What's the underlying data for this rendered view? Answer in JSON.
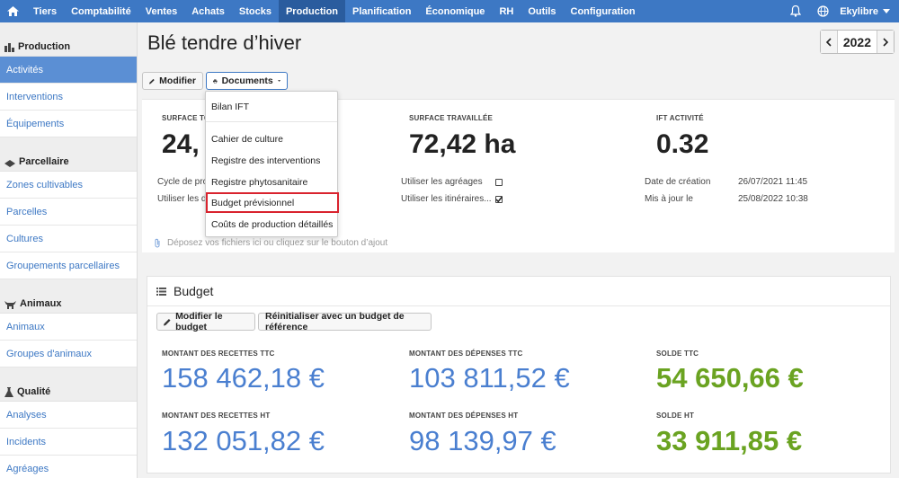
{
  "topnav": {
    "items": [
      "Tiers",
      "Comptabilité",
      "Ventes",
      "Achats",
      "Stocks",
      "Production",
      "Planification",
      "Économique",
      "RH",
      "Outils",
      "Configuration"
    ],
    "active": "Production",
    "user": "Ekylibre"
  },
  "sidebar": {
    "sections": [
      {
        "title": "Production",
        "items": [
          "Activités",
          "Interventions",
          "Équipements"
        ]
      },
      {
        "title": "Parcellaire",
        "items": [
          "Zones cultivables",
          "Parcelles",
          "Cultures",
          "Groupements parcellaires"
        ]
      },
      {
        "title": "Animaux",
        "items": [
          "Animaux",
          "Groupes d'animaux"
        ]
      },
      {
        "title": "Qualité",
        "items": [
          "Analyses",
          "Incidents",
          "Agréages"
        ]
      }
    ]
  },
  "page": {
    "title": "Blé tendre d’hiver",
    "year": "2022"
  },
  "toolbar": {
    "modify_label": "Modifier",
    "documents_label": "Documents"
  },
  "doc_menu": {
    "items": [
      "Bilan IFT",
      "Cahier de culture",
      "Registre des interventions",
      "Registre phytosanitaire",
      "Budget prévisionnel",
      "Coûts de production détaillés"
    ],
    "highlighted": "Budget prévisionnel"
  },
  "info": {
    "surface_total_label": "SURFACE TO",
    "surface_total_value": "24,",
    "surface_worked_label": "SURFACE TRAVAILLÉE",
    "surface_worked_value": "72,42 ha",
    "ift_label": "IFT ACTIVITÉ",
    "ift_value": "0.32",
    "cycle_label": "Cycle de pro",
    "use_label": "Utiliser les d",
    "use_agreages_label": "Utiliser les agréages",
    "use_itineraires_label": "Utiliser les itinéraires...",
    "created_label": "Date de création",
    "created_value": "26/07/2021 11:45",
    "updated_label": "Mis à jour le",
    "updated_value": "25/08/2022 10:38",
    "dropzone_text": "Déposez vos fichiers ici ou cliquez sur le bouton d’ajout"
  },
  "budget": {
    "title": "Budget",
    "edit_label": "Modifier le budget",
    "reset_label": "Réinitialiser avec un budget de référence",
    "recettes_ttc_label": "MONTANT DES RECETTES TTC",
    "recettes_ttc": "158 462,18 €",
    "depenses_ttc_label": "MONTANT DES DÉPENSES TTC",
    "depenses_ttc": "103 811,52 €",
    "solde_ttc_label": "SOLDE TTC",
    "solde_ttc": "54 650,66 €",
    "recettes_ht_label": "MONTANT DES RECETTES HT",
    "recettes_ht": "132 051,82 €",
    "depenses_ht_label": "MONTANT DES DÉPENSES HT",
    "depenses_ht": "98 139,97 €",
    "solde_ht_label": "SOLDE HT",
    "solde_ht": "33 911,85 €"
  },
  "colors": {
    "nav": "#3d78c4",
    "active_nav": "#2a5c9e",
    "link": "#3d78c4",
    "amount_blue": "#4a7fd0",
    "amount_green": "#6aa321",
    "highlight_border": "#d9232e"
  }
}
